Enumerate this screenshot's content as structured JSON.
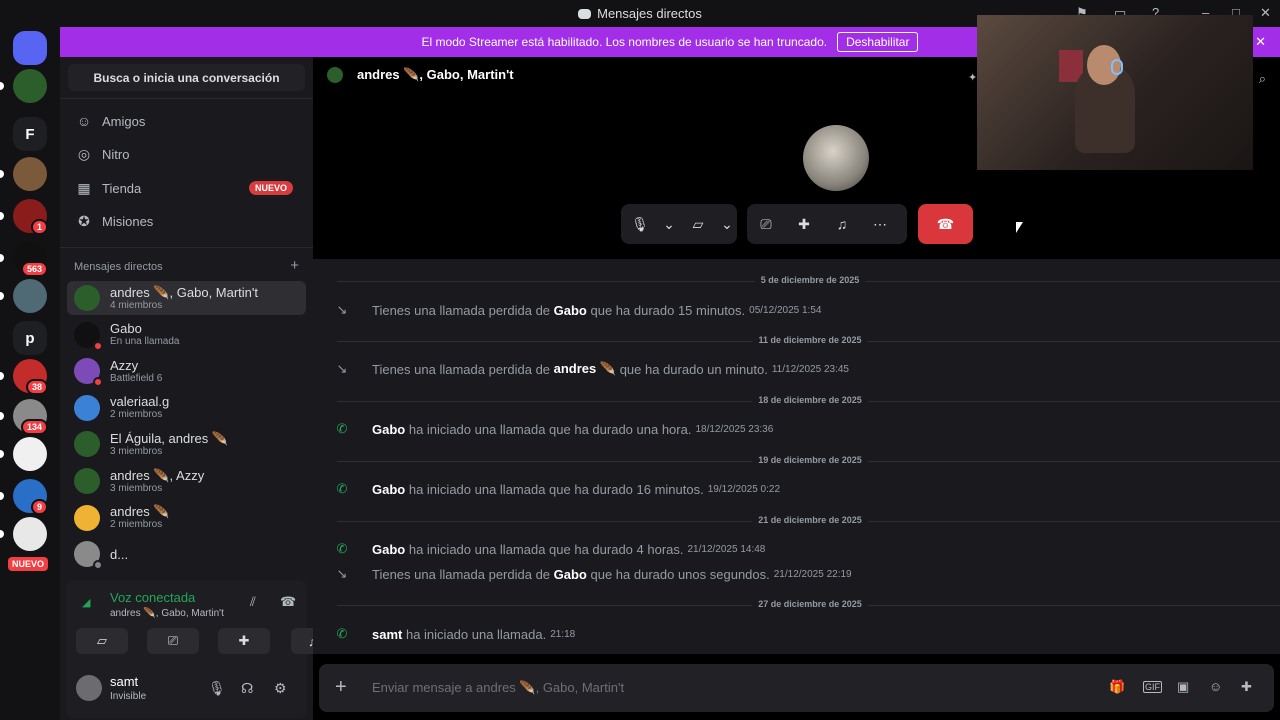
{
  "window": {
    "title": "Mensajes directos"
  },
  "banner": {
    "text": "El modo Streamer está habilitado. Los nombres de usuario se han truncado.",
    "button": "Deshabilitar"
  },
  "rail": {
    "servers": [
      {
        "label": "",
        "icon": "discord-icon",
        "color": "#5865f2"
      },
      {
        "label": "",
        "icon": "server-avatar",
        "color": "#2b5e2b"
      },
      {
        "label": "F",
        "icon": "letter",
        "color": "#1e1f22"
      },
      {
        "label": "",
        "icon": "server-avatar",
        "color": "#7a5a3a"
      },
      {
        "label": "",
        "icon": "server-avatar",
        "color": "#8b1c1c",
        "badge": "1"
      },
      {
        "label": "",
        "icon": "server-avatar",
        "color": "#101010",
        "badge": "563"
      },
      {
        "label": "",
        "icon": "server-avatar",
        "color": "#4f6a75"
      },
      {
        "label": "p",
        "icon": "letter",
        "color": "#1e1f22"
      },
      {
        "label": "",
        "icon": "server-avatar",
        "color": "#c42b2b",
        "badge": "38"
      },
      {
        "label": "",
        "icon": "server-avatar",
        "color": "#8a8a8a",
        "badge": "134"
      },
      {
        "label": "",
        "icon": "server-avatar",
        "color": "#f0f0f0"
      },
      {
        "label": "",
        "icon": "server-avatar",
        "color": "#2a6fc7",
        "badge": "9"
      },
      {
        "label": "",
        "icon": "server-avatar",
        "color": "#e8e8e8"
      }
    ],
    "new_tag": "NUEVO"
  },
  "sidebar": {
    "search": "Busca o inicia una conversación",
    "nav": [
      {
        "label": "Amigos",
        "icon": "friends-icon"
      },
      {
        "label": "Nitro",
        "icon": "nitro-icon"
      },
      {
        "label": "Tienda",
        "icon": "shop-icon",
        "badge": "NUEVO"
      },
      {
        "label": "Misiones",
        "icon": "quests-icon"
      }
    ],
    "dm_header": "Mensajes directos",
    "dms": [
      {
        "name": "andres 🪶, Gabo, Martin't",
        "sub": "4 miembros",
        "color": "#2b5e2b",
        "active": true
      },
      {
        "name": "Gabo",
        "sub": "En una llamada",
        "color": "#101010",
        "status": "#f23f43"
      },
      {
        "name": "Azzy",
        "sub": "Battlefield 6",
        "color": "#7d4bb8",
        "status": "#f23f43"
      },
      {
        "name": "valeriaal.g",
        "sub": "2 miembros",
        "color": "#3b82d6"
      },
      {
        "name": "El Águila, andres 🪶",
        "sub": "3 miembros",
        "color": "#2b5e2b"
      },
      {
        "name": "andres 🪶, Azzy",
        "sub": "3 miembros",
        "color": "#2b5e2b"
      },
      {
        "name": "andres 🪶",
        "sub": "2 miembros",
        "color": "#f0b232"
      },
      {
        "name": "d...",
        "sub": "",
        "color": "#8a8a8a",
        "status": "#80848e"
      }
    ],
    "voice": {
      "status": "Voz conectada",
      "channel": "andres 🪶, Gabo, Martin't"
    },
    "user": {
      "name": "samt",
      "status": "Invisible"
    }
  },
  "chat": {
    "header": "andres 🪶, Gabo, Martin't",
    "composer_placeholder": "Enviar mensaje a andres 🪶, Gabo, Martin't",
    "messages": [
      {
        "type": "day",
        "text": "5 de diciembre de 2025"
      },
      {
        "type": "missed",
        "pre": "Tienes una llamada perdida de ",
        "name": "Gabo",
        "post": " que ha durado 15 minutos.",
        "ts": "05/12/2025 1:54"
      },
      {
        "type": "day",
        "text": "11 de diciembre de 2025"
      },
      {
        "type": "missed",
        "pre": "Tienes una llamada perdida de ",
        "name": "andres 🪶",
        "post": " que ha durado un minuto.",
        "ts": "11/12/2025 23:45"
      },
      {
        "type": "day",
        "text": "18 de diciembre de 2025"
      },
      {
        "type": "call",
        "pre": "",
        "name": "Gabo",
        "post": " ha iniciado una llamada que ha durado una hora.",
        "ts": "18/12/2025 23:36"
      },
      {
        "type": "day",
        "text": "19 de diciembre de 2025"
      },
      {
        "type": "call",
        "pre": "",
        "name": "Gabo",
        "post": " ha iniciado una llamada que ha durado 16 minutos.",
        "ts": "19/12/2025 0:22"
      },
      {
        "type": "day",
        "text": "21 de diciembre de 2025"
      },
      {
        "type": "call",
        "pre": "",
        "name": "Gabo",
        "post": " ha iniciado una llamada que ha durado 4 horas.",
        "ts": "21/12/2025 14:48"
      },
      {
        "type": "missed",
        "pre": "Tienes una llamada perdida de ",
        "name": "Gabo",
        "post": " que ha durado unos segundos.",
        "ts": "21/12/2025 22:19"
      },
      {
        "type": "day",
        "text": "27 de diciembre de 2025"
      },
      {
        "type": "call",
        "pre": "",
        "name": "samt",
        "post": " ha iniciado una llamada.",
        "ts": "21:18"
      }
    ]
  }
}
